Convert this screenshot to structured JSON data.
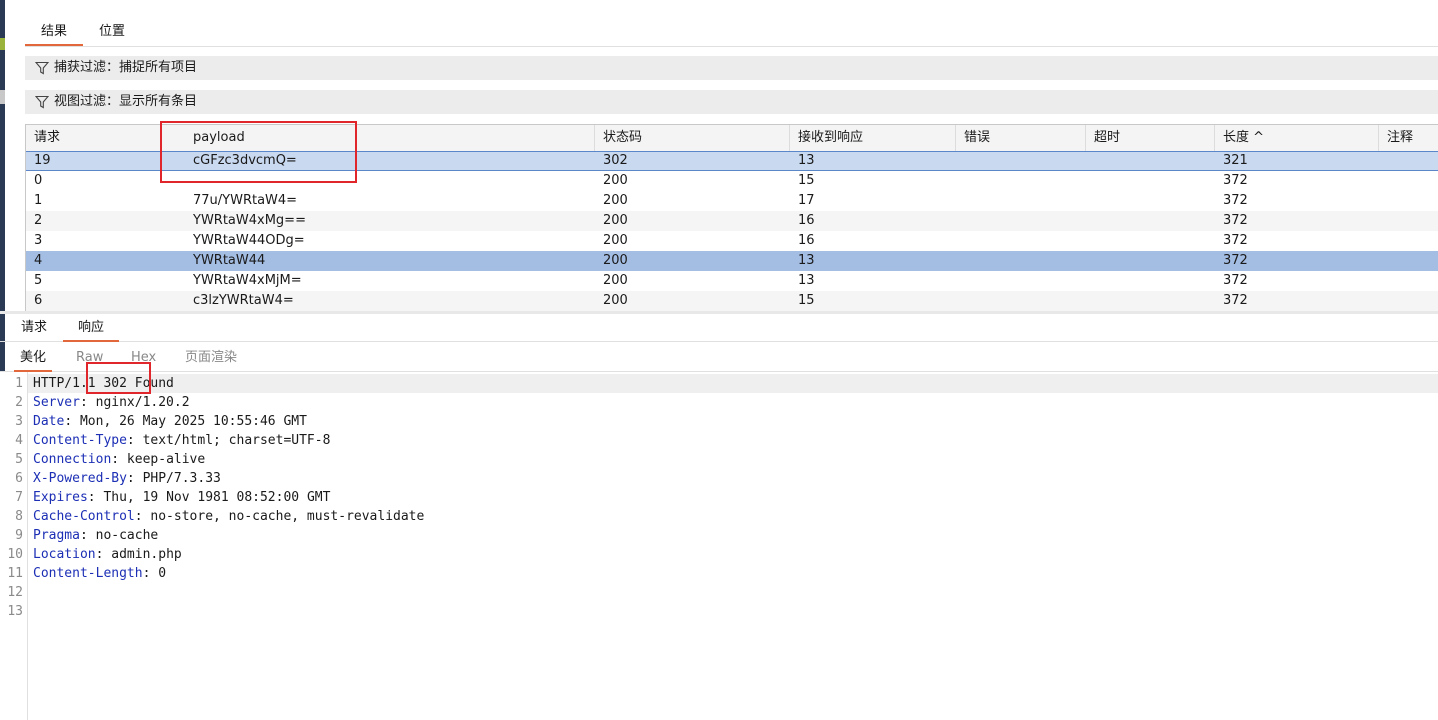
{
  "top_tabs": [
    "结果",
    "位置"
  ],
  "capture_filter": "捕获过滤：捕捉所有项目",
  "view_filter": "视图过滤：显示所有条目",
  "columns": [
    "请求",
    "payload",
    "状态码",
    "接收到响应",
    "错误",
    "超时",
    "长度 ^",
    "注释"
  ],
  "rows": [
    {
      "req": "19",
      "payload": "cGFzc3dvcmQ=",
      "status": "302",
      "resp": "13",
      "len": "321"
    },
    {
      "req": "0",
      "payload": "",
      "status": "200",
      "resp": "15",
      "len": "372"
    },
    {
      "req": "1",
      "payload": "77u/YWRtaW4=",
      "status": "200",
      "resp": "17",
      "len": "372"
    },
    {
      "req": "2",
      "payload": "YWRtaW4xMg==",
      "status": "200",
      "resp": "16",
      "len": "372"
    },
    {
      "req": "3",
      "payload": "YWRtaW44ODg=",
      "status": "200",
      "resp": "16",
      "len": "372"
    },
    {
      "req": "4",
      "payload": "YWRtaW44",
      "status": "200",
      "resp": "13",
      "len": "372"
    },
    {
      "req": "5",
      "payload": "YWRtaW4xMjM=",
      "status": "200",
      "resp": "13",
      "len": "372"
    },
    {
      "req": "6",
      "payload": "c3lzYWRtaW4=",
      "status": "200",
      "resp": "15",
      "len": "372"
    }
  ],
  "req_resp_tabs": [
    "请求",
    "响应"
  ],
  "view_tabs": [
    "美化",
    "Raw",
    "Hex",
    "页面渲染"
  ],
  "line_numbers": [
    "1",
    "2",
    "3",
    "4",
    "5",
    "6",
    "7",
    "8",
    "9",
    "10",
    "11",
    "12",
    "13"
  ],
  "response": {
    "status_line": "HTTP/1.1 302 Found",
    "headers": [
      {
        "key": "Server",
        "value": ": nginx/1.20.2"
      },
      {
        "key": "Date",
        "value": ": Mon, 26 May 2025 10:55:46 GMT"
      },
      {
        "key": "Content-Type",
        "value": ": text/html; charset=UTF-8"
      },
      {
        "key": "Connection",
        "value": ": keep-alive"
      },
      {
        "key": "X-Powered-By",
        "value": ": PHP/7.3.33"
      },
      {
        "key": "Expires",
        "value": ": Thu, 19 Nov 1981 08:52:00 GMT"
      },
      {
        "key": "Cache-Control",
        "value": ": no-store, no-cache, must-revalidate"
      },
      {
        "key": "Pragma",
        "value": ": no-cache"
      },
      {
        "key": "Location",
        "value": ": admin.php"
      },
      {
        "key": "Content-Length",
        "value": ": 0"
      }
    ]
  },
  "colors": {
    "accent": "#e2683c",
    "highlight_box": "#e0262b",
    "header_key": "#1c2fb5",
    "selected_row": "#c9d9f0",
    "selected_row_2": "#a3bde3"
  }
}
